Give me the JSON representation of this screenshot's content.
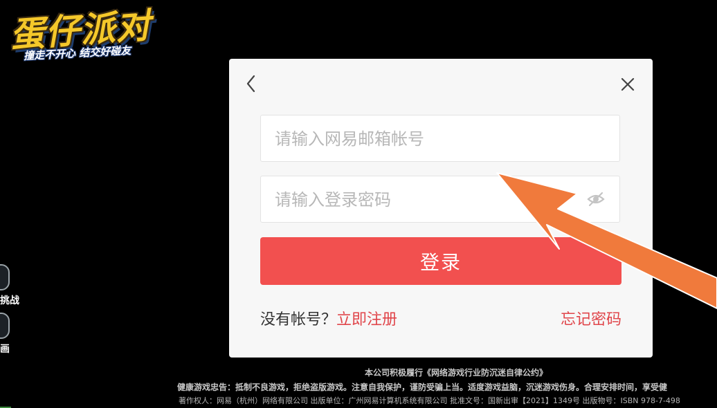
{
  "background": {
    "logo": {
      "title": "蛋仔派对",
      "slogan": "撞走不开心 结交好碰友"
    },
    "side_labels": [
      "挑战",
      "画"
    ]
  },
  "dialog": {
    "back_icon": "chevron-left-icon",
    "close_icon": "close-icon",
    "email_placeholder": "请输入网易邮箱帐号",
    "email_value": "",
    "password_placeholder": "请输入登录密码",
    "password_value": "",
    "visibility_icon": "eye-off-icon",
    "login_label": "登录",
    "no_account_text": "没有帐号？",
    "register_label": "立即注册",
    "forgot_label": "忘记密码"
  },
  "footer": {
    "line1": "本公司积极履行《网络游戏行业防沉迷自律公约》",
    "line2": "健康游戏忠告：抵制不良游戏，拒绝盗版游戏。注意自我保护，谨防受骗上当。适度游戏益脑，沉迷游戏伤身。合理安排时间，享受健",
    "line3": "著作权人：网易（杭州）网络有限公司 出版单位：广州网易计算机系统有限公司 批准文号：国新出审【2021】1349号 出版物号：ISBN 978-7-498"
  },
  "colors": {
    "accent": "#f2504f",
    "link": "#e0454a",
    "annotation_arrow": "#f07a3c",
    "dialog_bg": "#f7f7f7"
  }
}
